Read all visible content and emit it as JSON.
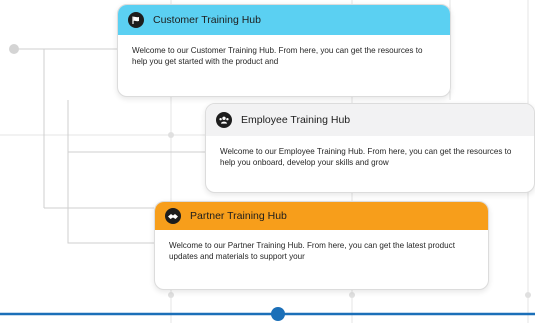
{
  "cards": [
    {
      "title": "Customer Training Hub",
      "icon": "flag-icon",
      "header_color": "#5bd0f2",
      "body": "Welcome to our Customer Training Hub. From here, you can get the resources to help you get started with the product and"
    },
    {
      "title": "Employee Training Hub",
      "icon": "people-icon",
      "header_color": "#f2f2f3",
      "body": "Welcome to our Employee Training Hub. From here, you can get the resources to help you onboard, develop your skills and grow"
    },
    {
      "title": "Partner Training Hub",
      "icon": "handshake-icon",
      "header_color": "#f79e1b",
      "body": "Welcome to our Partner Training Hub. From here, you can get the latest product updates and materials to support your"
    }
  ],
  "colors": {
    "timeline": "#1b6fb8",
    "grid_lines": "#e2e2e2"
  }
}
